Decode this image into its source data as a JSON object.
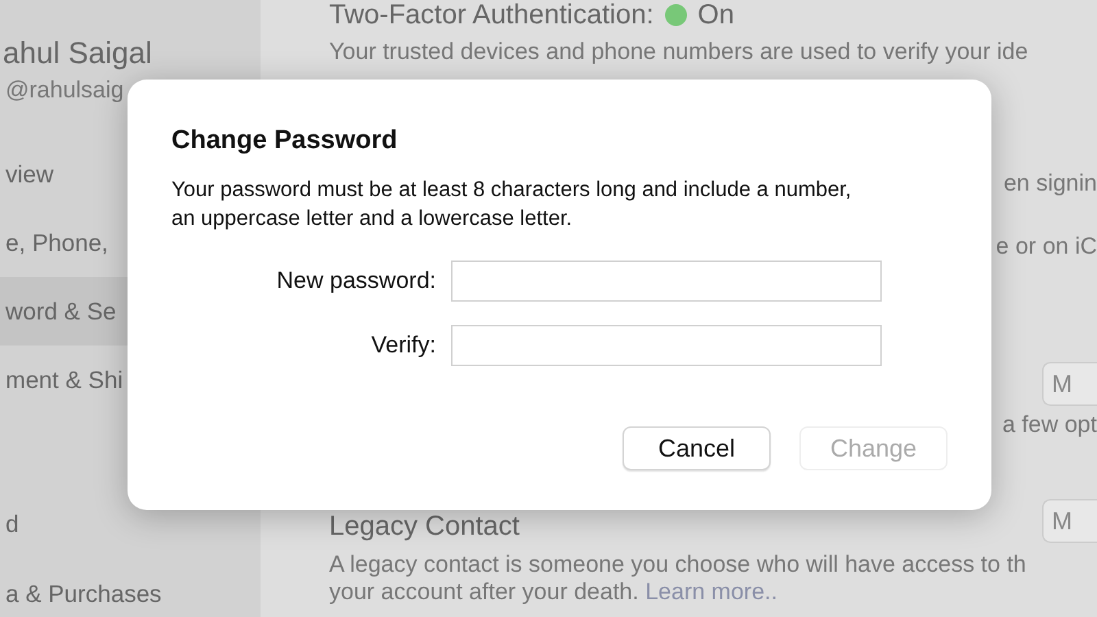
{
  "sidebar": {
    "name": "ahul Saigal",
    "handle": "@rahulsaig",
    "items": [
      {
        "label": "view",
        "selected": false
      },
      {
        "label": "e, Phone,",
        "selected": false
      },
      {
        "label": "word & Se",
        "selected": true
      },
      {
        "label": "ment & Shi",
        "selected": false
      }
    ],
    "section": "d",
    "section_item": "a & Purchases"
  },
  "main": {
    "two_factor": {
      "label": "Two-Factor Authentication:",
      "status": "On",
      "color": "#78c878"
    },
    "two_factor_text": "Your trusted devices and phone numbers are used to verify your ide",
    "fragments": [
      "en signin",
      "e or on iC",
      "a few opt"
    ],
    "buttons": [
      "M",
      "M"
    ],
    "legacy": {
      "title": "Legacy Contact",
      "text": "A legacy contact is someone you choose who will have access to th",
      "text_2": "your account after your death.",
      "link": "Learn more.."
    }
  },
  "dialog": {
    "title": "Change Password",
    "message": "Your password must be at least 8 characters long and include a number, an uppercase letter and a lowercase letter.",
    "fields": [
      {
        "label": "New password:"
      },
      {
        "label": "Verify:"
      }
    ],
    "buttons": [
      {
        "label": "Cancel",
        "disabled": false
      },
      {
        "label": "Change",
        "disabled": true
      }
    ]
  }
}
